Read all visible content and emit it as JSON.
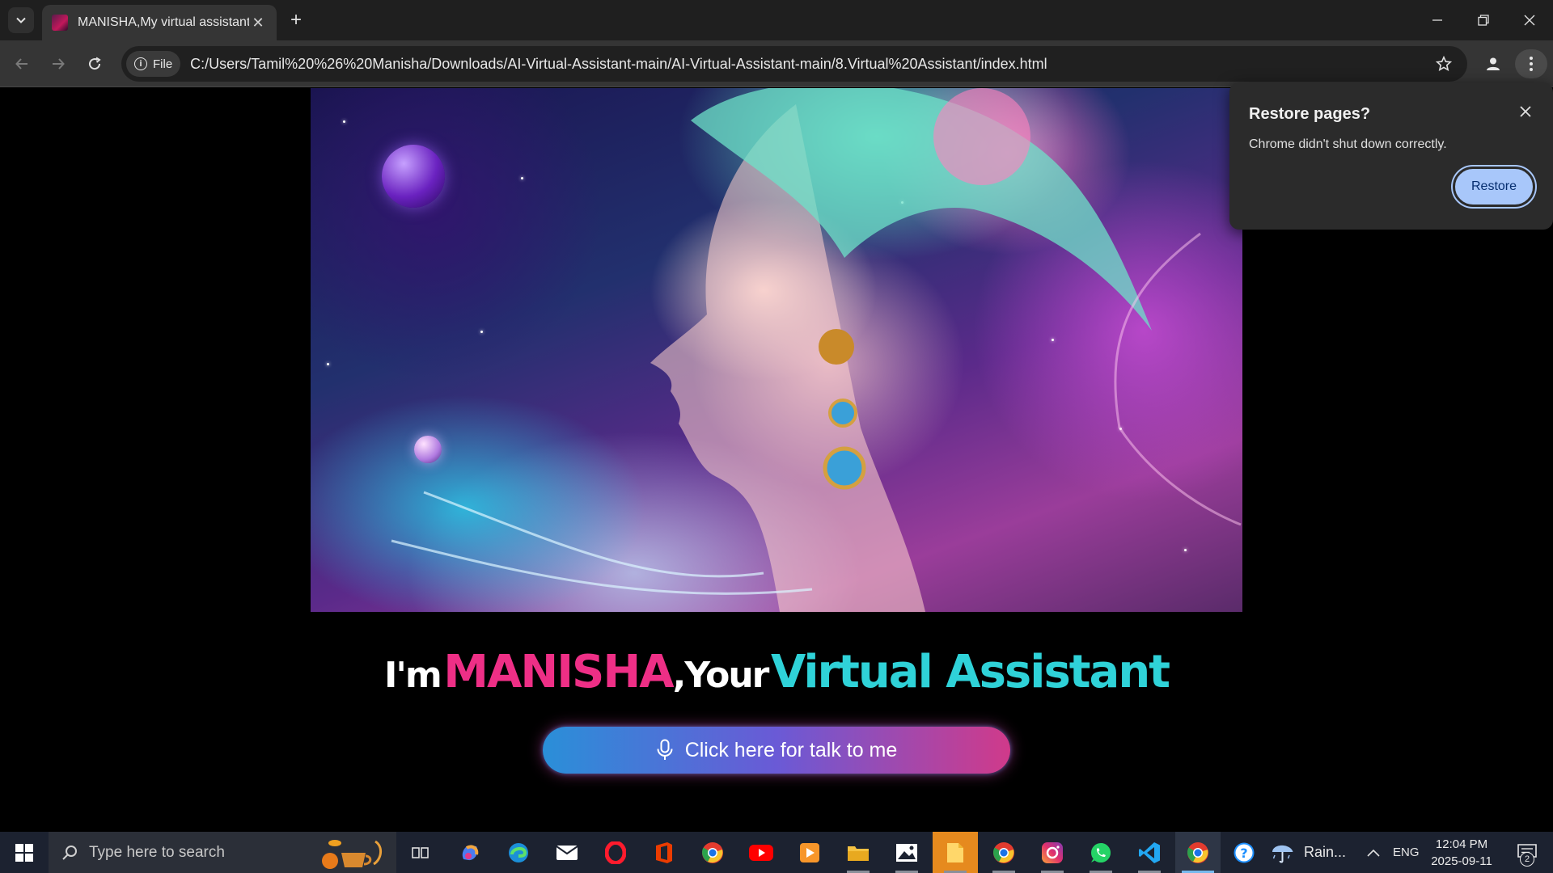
{
  "browser": {
    "tab": {
      "title": "MANISHA,My virtual assistant",
      "close_label": "✕"
    },
    "new_tab_label": "+",
    "address": {
      "chip_label": "File",
      "url": "C:/Users/Tamil%20%26%20Manisha/Downloads/AI-Virtual-Assistant-main/AI-Virtual-Assistant-main/8.Virtual%20Assistant/index.html"
    }
  },
  "page": {
    "headline": {
      "prefix": "I'm",
      "name": "MANISHA",
      "middle": ",Your",
      "suffix": "Virtual Assistant"
    },
    "talk_button_label": "Click here for talk to me",
    "colors": {
      "name": "#ee2f86",
      "suffix": "#2fd2d8",
      "button_start": "#2a8fd8",
      "button_end": "#d03a8a"
    }
  },
  "restore_popup": {
    "title": "Restore pages?",
    "message": "Chrome didn't shut down correctly.",
    "restore_label": "Restore"
  },
  "taskbar": {
    "search_placeholder": "Type here to search",
    "weather": "Rain...",
    "language": "ENG",
    "time": "12:04 PM",
    "date": "2025-09-11",
    "notification_count": "2",
    "apps": [
      "task-view-icon",
      "copilot-icon",
      "edge-icon",
      "mail-icon",
      "opera-icon",
      "office-icon",
      "chrome-icon",
      "youtube-icon",
      "media-player-icon",
      "file-explorer-icon",
      "photos-icon",
      "files-icon",
      "chrome-icon",
      "instagram-icon",
      "whatsapp-icon",
      "vscode-icon",
      "chrome-icon",
      "help-icon"
    ]
  }
}
